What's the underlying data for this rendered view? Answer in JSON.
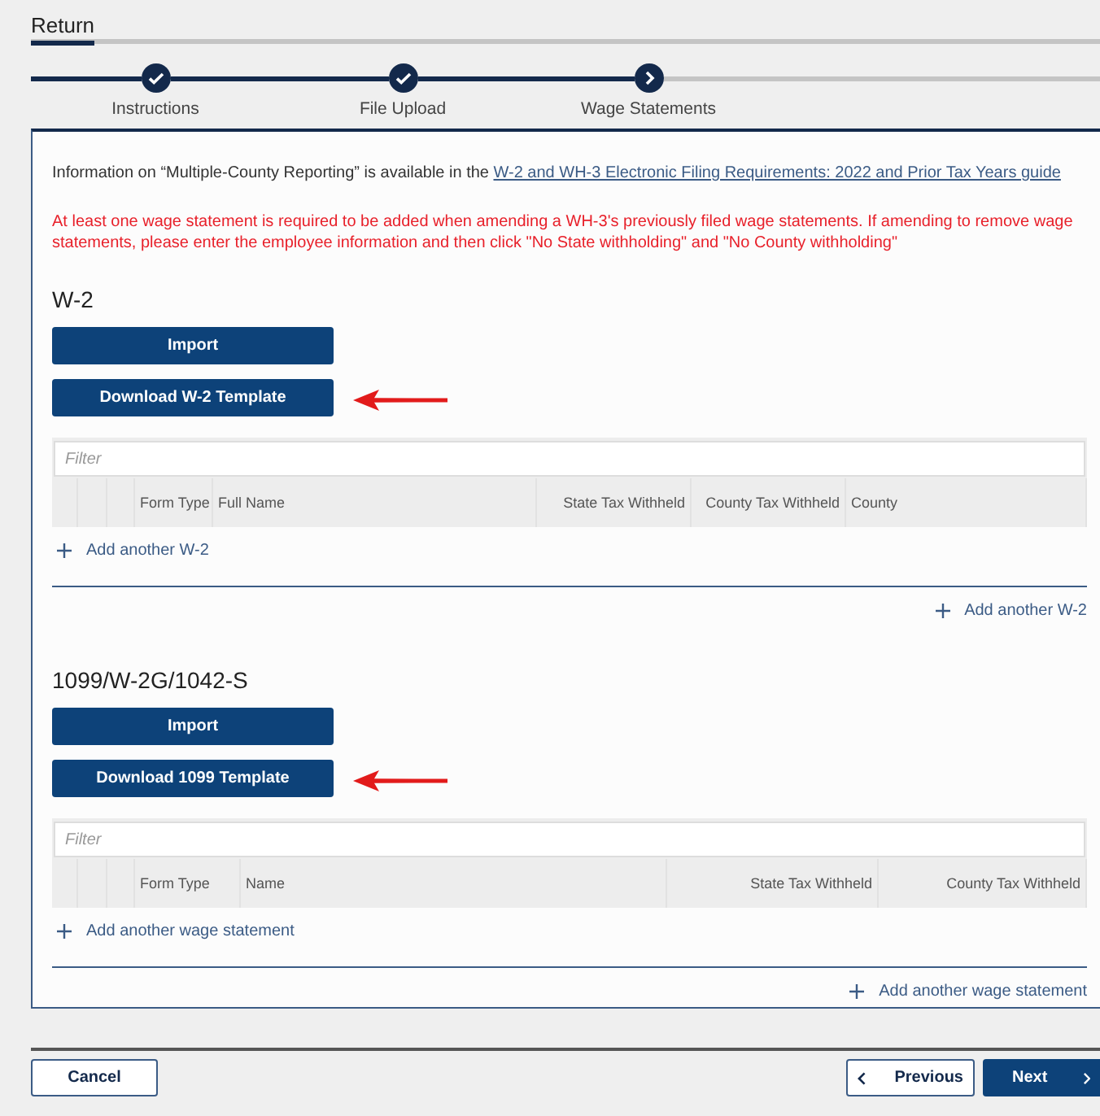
{
  "tab": {
    "label": "Return",
    "selected": true
  },
  "steps": [
    {
      "label": "Instructions",
      "completed": true
    },
    {
      "label": "File Upload",
      "completed": true
    },
    {
      "label": "Wage Statements",
      "completed": false
    }
  ],
  "info": {
    "text": "Information on “Multiple-County Reporting” is available in the ",
    "link": "W-2 and WH-3 Electronic Filing Requirements: 2022 and Prior Tax Years guide"
  },
  "warning": "At least one wage statement is required to be added when amending a WH-3's previously filed wage statements. If amending to remove wage statements, please enter the employee information and then click \"No State withholding\" and \"No County withholding\"",
  "sections": [
    {
      "title": "W-2",
      "import_button": "Import",
      "download_button": "Download W-2 Template",
      "filter_placeholder": "Filter",
      "columns": [
        "Form Type",
        "Full Name",
        "State Tax Withheld",
        "County Tax Withheld",
        "County"
      ],
      "add_link": "Add another W-2",
      "add_link_bottom": "Add another W-2"
    },
    {
      "title": "1099/W-2G/1042-S",
      "import_button": "Import",
      "download_button": "Download 1099 Template",
      "filter_placeholder": "Filter",
      "columns": [
        "Form Type",
        "Name",
        "State Tax Withheld",
        "County Tax Withheld"
      ],
      "add_link": "Add another wage statement",
      "add_link_bottom": "Add another wage statement"
    }
  ],
  "buttons": {
    "cancel": "Cancel",
    "previous": "Previous",
    "next": "Next"
  }
}
